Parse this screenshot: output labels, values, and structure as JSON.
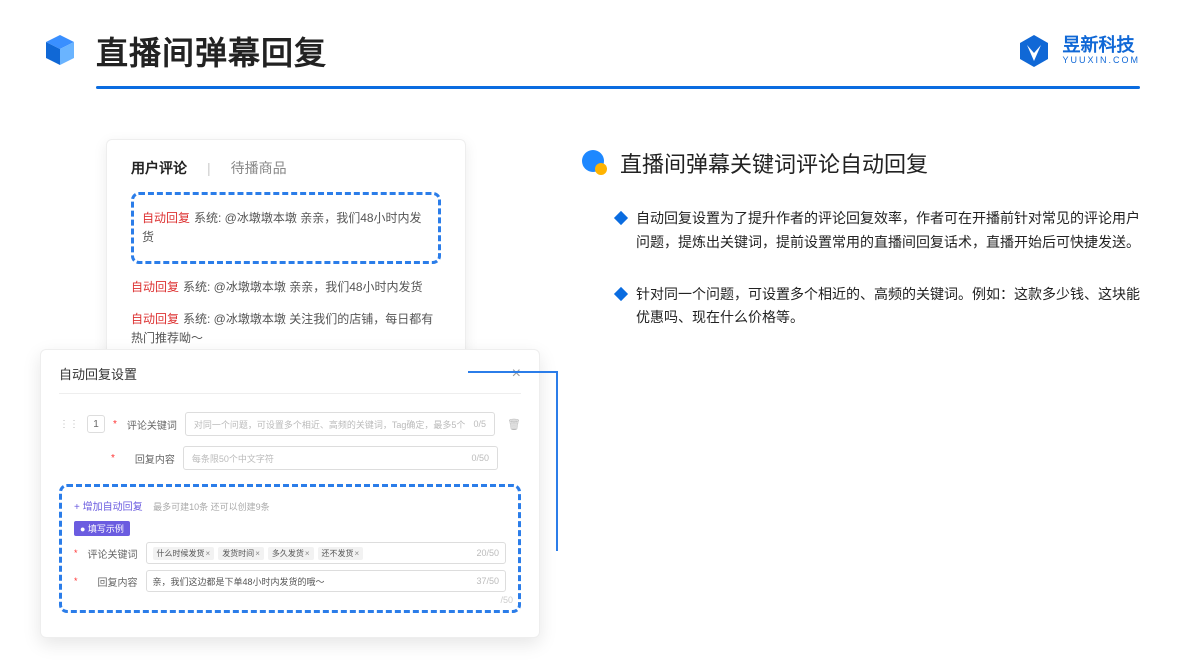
{
  "header": {
    "title": "直播间弹幕回复",
    "brand_cn": "昱新科技",
    "brand_en": "YUUXIN.COM"
  },
  "comments_panel": {
    "tab_active": "用户评论",
    "tab_other": "待播商品",
    "highlighted": "自动回复 系统: @冰墩墩本墩 亲亲，我们48小时内发货",
    "highlighted_tag": "自动回复",
    "highlighted_text": "系统: @冰墩墩本墩 亲亲，我们48小时内发货",
    "c2_tag": "自动回复",
    "c2_text": "系统: @冰墩墩本墩 亲亲，我们48小时内发货",
    "c3_tag": "自动回复",
    "c3_text": "系统: @冰墩墩本墩 关注我们的店铺，每日都有热门推荐呦～"
  },
  "settings": {
    "title": "自动回复设置",
    "num": "1",
    "label_keyword": "评论关键词",
    "placeholder_keyword": "对同一个问题，可设置多个相近、高频的关键词，Tag确定，最多5个",
    "counter_keyword": "0/5",
    "label_reply": "回复内容",
    "placeholder_reply": "每条限50个中文字符",
    "counter_reply": "0/50",
    "add_link": "+ 增加自动回复",
    "add_hint": "最多可建10条 还可以创建9条",
    "example_badge": "● 填写示例",
    "ex_label_keyword": "评论关键词",
    "ex_tags": [
      "什么时候发货",
      "发货时间",
      "多久发货",
      "还不发货"
    ],
    "ex_counter_kw": "20/50",
    "ex_label_reply": "回复内容",
    "ex_reply_text": "亲，我们这边都是下单48小时内发货的哦～",
    "ex_counter_reply": "37/50",
    "faded_counter": "/50"
  },
  "right": {
    "title": "直播间弹幕关键词评论自动回复",
    "b1": "自动回复设置为了提升作者的评论回复效率，作者可在开播前针对常见的评论用户问题，提炼出关键词，提前设置常用的直播间回复话术，直播开始后可快捷发送。",
    "b2": "针对同一个问题，可设置多个相近的、高频的关键词。例如：这款多少钱、这块能优惠吗、现在什么价格等。"
  }
}
